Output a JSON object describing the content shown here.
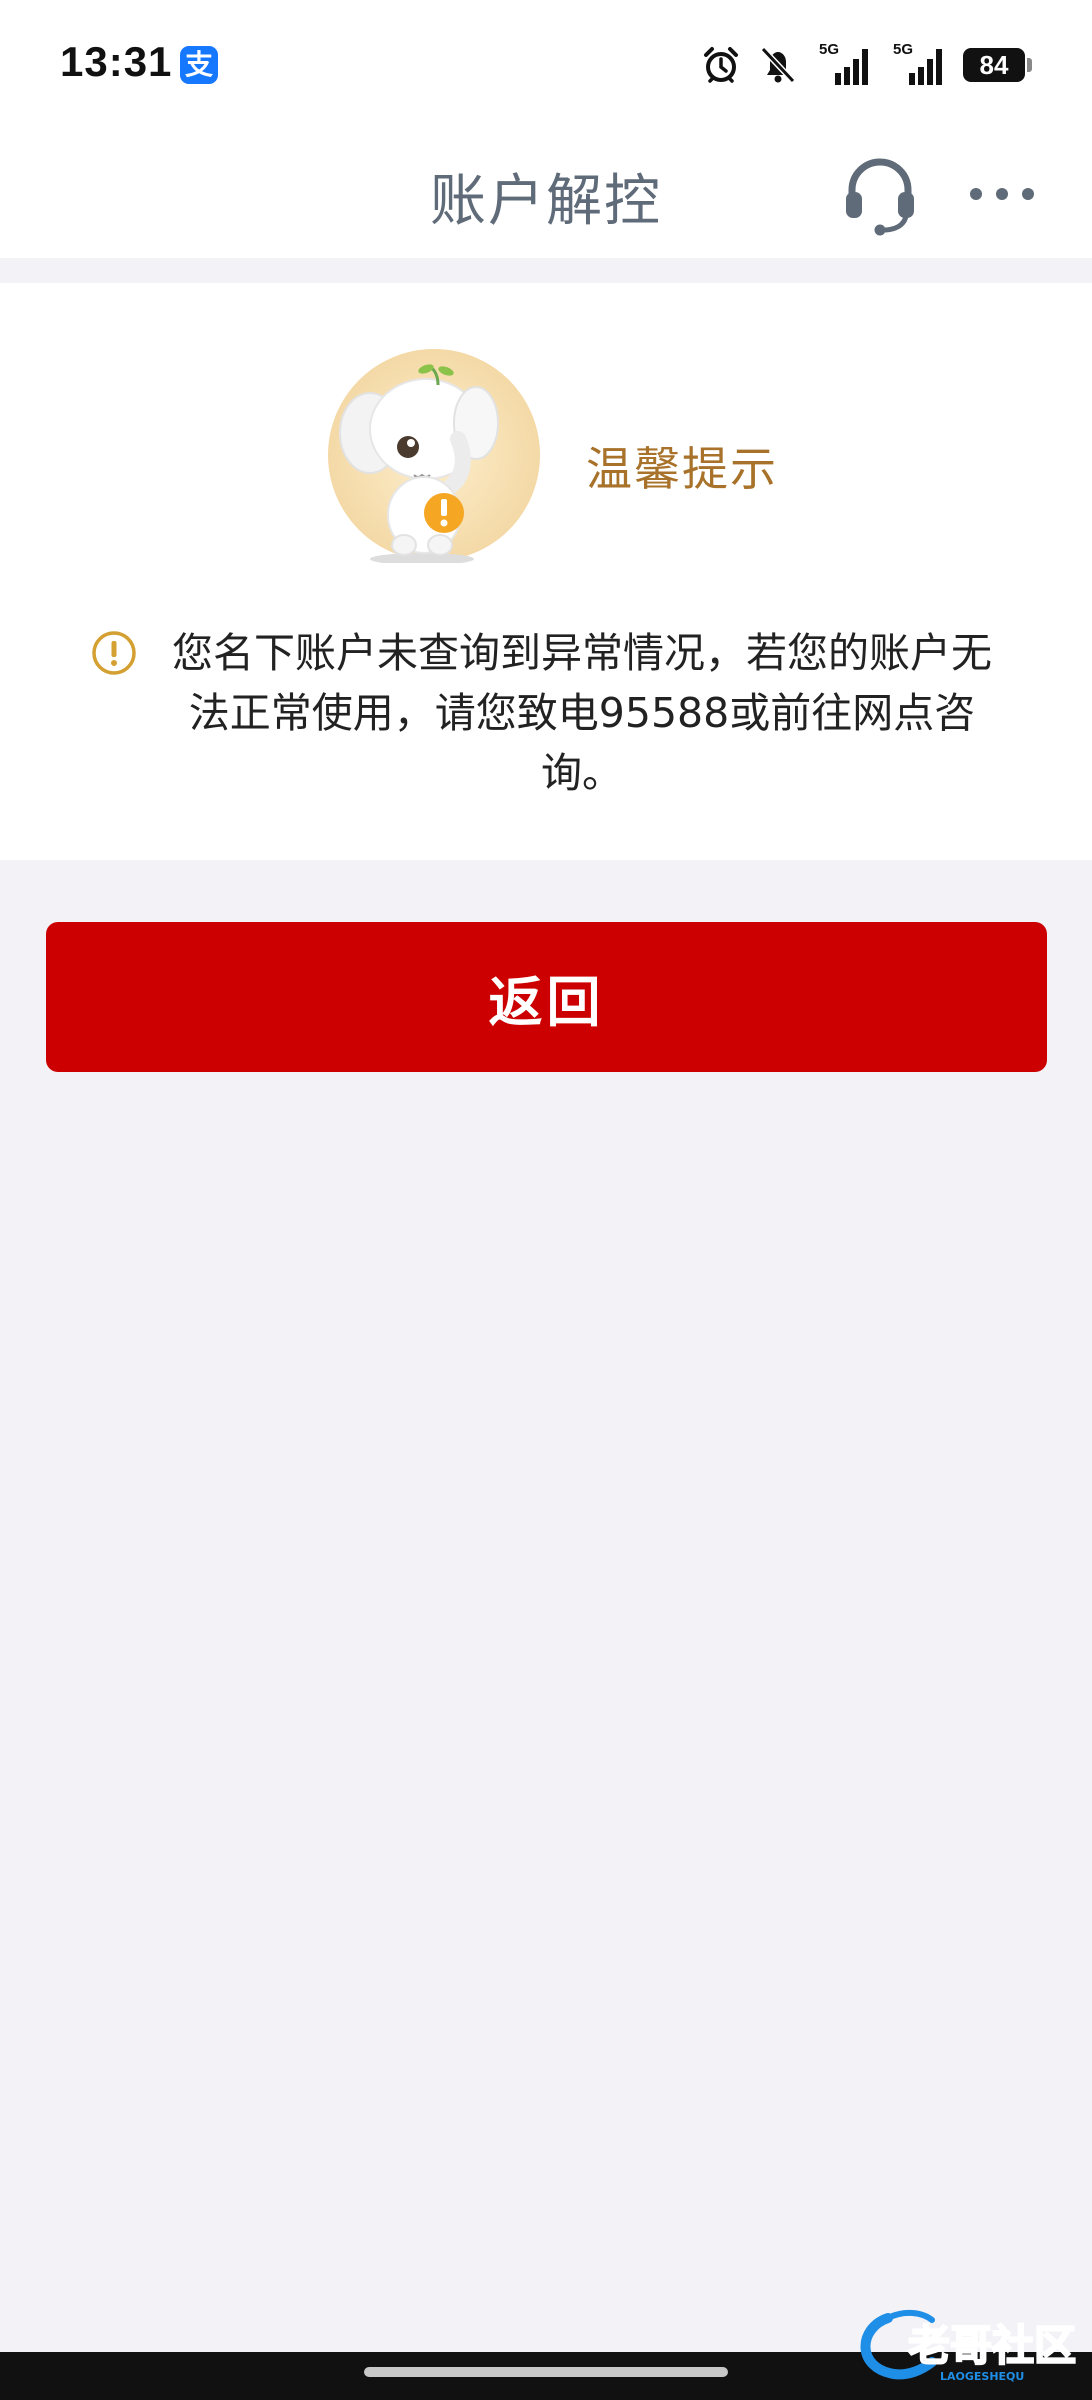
{
  "status_bar": {
    "time": "13:31",
    "app_badge": "支",
    "network_1": "5G",
    "network_2": "5G",
    "battery": "84"
  },
  "nav": {
    "title": "账户解控"
  },
  "card": {
    "tip_title": "温馨提示",
    "notice_text": "您名下账户未查询到异常情况，若您的账户无法正常使用，请您致电95588或前往网点咨询。"
  },
  "actions": {
    "return_label": "返回"
  },
  "colors": {
    "primary_red": "#cc0000",
    "tip_gold": "#a8722a",
    "nav_title": "#5f6b78",
    "page_bg": "#f2f2f7"
  },
  "icons": {
    "status": [
      "alarm-icon",
      "bell-off-icon",
      "signal-icon",
      "signal-icon",
      "battery-icon"
    ],
    "nav": [
      "headset-icon",
      "more-icon"
    ],
    "notice": "warning-circle-icon"
  }
}
